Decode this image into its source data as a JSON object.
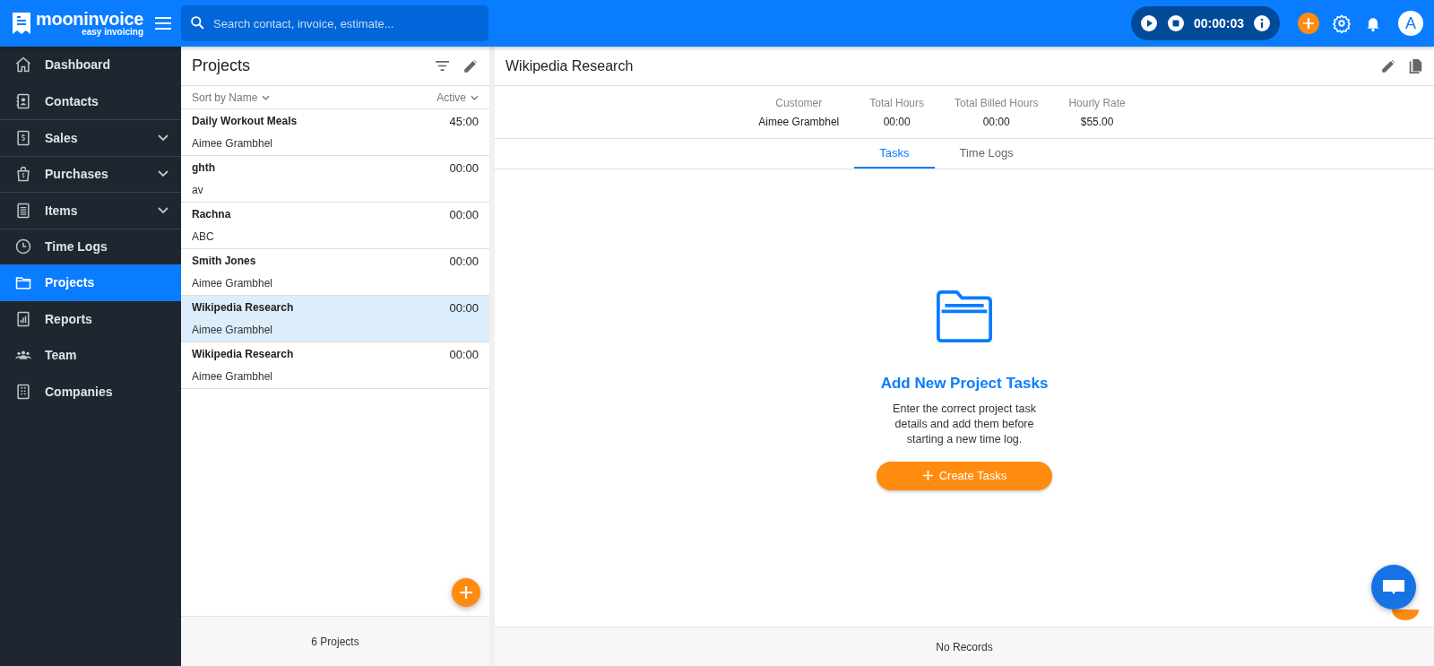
{
  "header": {
    "logo": {
      "name": "mooninvoice",
      "tagline": "easy invoicing"
    },
    "search": {
      "placeholder": "Search contact, invoice, estimate..."
    },
    "timer": {
      "time": "00:00:03"
    },
    "avatar": "A"
  },
  "sidebar": {
    "items": [
      {
        "label": "Dashboard",
        "selected": false,
        "expandable": false
      },
      {
        "label": "Contacts",
        "selected": false,
        "expandable": false
      },
      {
        "label": "Sales",
        "selected": false,
        "expandable": true
      },
      {
        "label": "Purchases",
        "selected": false,
        "expandable": true
      },
      {
        "label": "Items",
        "selected": false,
        "expandable": true
      },
      {
        "label": "Time Logs",
        "selected": false,
        "expandable": false
      },
      {
        "label": "Projects",
        "selected": true,
        "expandable": false
      },
      {
        "label": "Reports",
        "selected": false,
        "expandable": false
      },
      {
        "label": "Team",
        "selected": false,
        "expandable": false
      },
      {
        "label": "Companies",
        "selected": false,
        "expandable": false
      }
    ]
  },
  "projects_panel": {
    "title": "Projects",
    "sort": "Sort by Name",
    "filter": "Active",
    "projects": [
      {
        "name": "Daily Workout Meals",
        "customer": "Aimee Grambhel",
        "hours": "45:00",
        "selected": false
      },
      {
        "name": "ghth",
        "customer": "av",
        "hours": "00:00",
        "selected": false
      },
      {
        "name": "Rachna",
        "customer": "ABC",
        "hours": "00:00",
        "selected": false
      },
      {
        "name": "Smith Jones",
        "customer": "Aimee Grambhel",
        "hours": "00:00",
        "selected": false
      },
      {
        "name": "Wikipedia Research",
        "customer": "Aimee Grambhel",
        "hours": "00:00",
        "selected": true
      },
      {
        "name": "Wikipedia Research",
        "customer": "Aimee Grambhel",
        "hours": "00:00",
        "selected": false
      }
    ],
    "footer": "6 Projects"
  },
  "detail": {
    "title": "Wikipedia Research",
    "stats": [
      {
        "label": "Customer",
        "value": "Aimee Grambhel"
      },
      {
        "label": "Total Hours",
        "value": "00:00"
      },
      {
        "label": "Total Billed Hours",
        "value": "00:00"
      },
      {
        "label": "Hourly Rate",
        "value": "$55.00"
      }
    ],
    "tabs": [
      {
        "label": "Tasks",
        "selected": true
      },
      {
        "label": "Time Logs",
        "selected": false
      }
    ],
    "empty": {
      "heading": "Add New Project Tasks",
      "message": "Enter the correct project task details and add them before starting a new time log.",
      "button": "Create Tasks"
    },
    "footer": "No Records"
  }
}
